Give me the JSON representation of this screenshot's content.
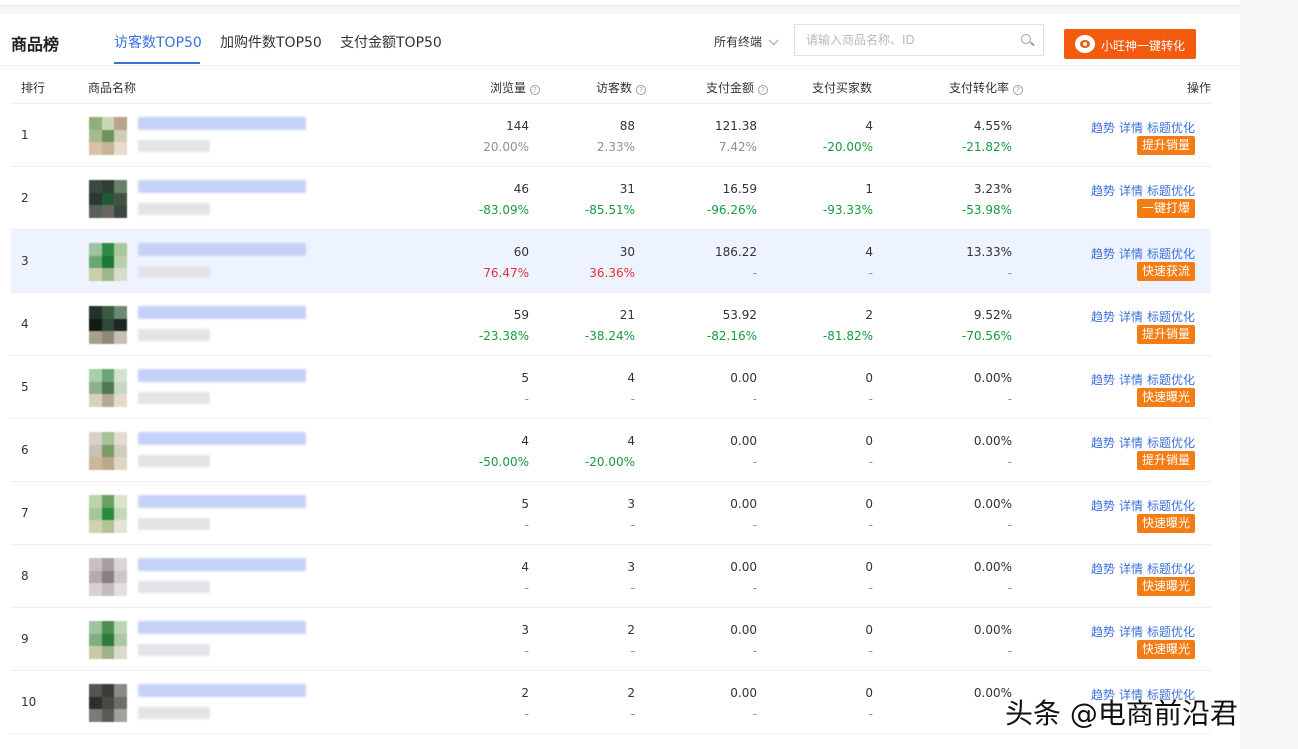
{
  "header": {
    "title": "商品榜",
    "tabs": [
      {
        "label": "访客数TOP50",
        "active": true
      },
      {
        "label": "加购件数TOP50",
        "active": false
      },
      {
        "label": "支付金额TOP50",
        "active": false
      }
    ],
    "device_filter": "所有终端",
    "search_placeholder": "请输入商品名称、ID",
    "convert_button": "小旺神一键转化"
  },
  "colors": {
    "accent": "#3d6fdb",
    "brand_orange": "#f35a0e",
    "tag_orange": "#f37c14",
    "down_green": "#1a9a3c",
    "up_red": "#e0313a"
  },
  "table": {
    "columns": {
      "rank": "排行",
      "name": "商品名称",
      "views": "浏览量",
      "visitors": "访客数",
      "pay_amount": "支付金额",
      "buyers": "支付买家数",
      "conversion": "支付转化率",
      "ops": "操作"
    },
    "op_links": {
      "trend": "趋势",
      "detail": "详情",
      "title_opt": "标题优化"
    },
    "rows": [
      {
        "rank": "1",
        "views": "144",
        "views_chg": "20.00%",
        "visitors": "88",
        "visitors_chg": "2.33%",
        "pay": "121.38",
        "pay_chg": "7.42%",
        "buyers": "4",
        "buyers_chg": "-20.00%",
        "conv": "4.55%",
        "conv_chg": "-21.82%",
        "action": "提升销量"
      },
      {
        "rank": "2",
        "views": "46",
        "views_chg": "-83.09%",
        "visitors": "31",
        "visitors_chg": "-85.51%",
        "pay": "16.59",
        "pay_chg": "-96.26%",
        "buyers": "1",
        "buyers_chg": "-93.33%",
        "conv": "3.23%",
        "conv_chg": "-53.98%",
        "action": "一键打爆"
      },
      {
        "rank": "3",
        "views": "60",
        "views_chg": "76.47%",
        "visitors": "30",
        "visitors_chg": "36.36%",
        "pay": "186.22",
        "pay_chg": "-",
        "buyers": "4",
        "buyers_chg": "-",
        "conv": "13.33%",
        "conv_chg": "-",
        "action": "快速获流"
      },
      {
        "rank": "4",
        "views": "59",
        "views_chg": "-23.38%",
        "visitors": "21",
        "visitors_chg": "-38.24%",
        "pay": "53.92",
        "pay_chg": "-82.16%",
        "buyers": "2",
        "buyers_chg": "-81.82%",
        "conv": "9.52%",
        "conv_chg": "-70.56%",
        "action": "提升销量"
      },
      {
        "rank": "5",
        "views": "5",
        "views_chg": "-",
        "visitors": "4",
        "visitors_chg": "-",
        "pay": "0.00",
        "pay_chg": "-",
        "buyers": "0",
        "buyers_chg": "-",
        "conv": "0.00%",
        "conv_chg": "-",
        "action": "快速曝光"
      },
      {
        "rank": "6",
        "views": "4",
        "views_chg": "-50.00%",
        "visitors": "4",
        "visitors_chg": "-20.00%",
        "pay": "0.00",
        "pay_chg": "-",
        "buyers": "0",
        "buyers_chg": "-",
        "conv": "0.00%",
        "conv_chg": "-",
        "action": "提升销量"
      },
      {
        "rank": "7",
        "views": "5",
        "views_chg": "-",
        "visitors": "3",
        "visitors_chg": "-",
        "pay": "0.00",
        "pay_chg": "-",
        "buyers": "0",
        "buyers_chg": "-",
        "conv": "0.00%",
        "conv_chg": "-",
        "action": "快速曝光"
      },
      {
        "rank": "8",
        "views": "4",
        "views_chg": "-",
        "visitors": "3",
        "visitors_chg": "-",
        "pay": "0.00",
        "pay_chg": "-",
        "buyers": "0",
        "buyers_chg": "-",
        "conv": "0.00%",
        "conv_chg": "-",
        "action": "快速曝光"
      },
      {
        "rank": "9",
        "views": "3",
        "views_chg": "-",
        "visitors": "2",
        "visitors_chg": "-",
        "pay": "0.00",
        "pay_chg": "-",
        "buyers": "0",
        "buyers_chg": "-",
        "conv": "0.00%",
        "conv_chg": "-",
        "action": "快速曝光"
      },
      {
        "rank": "10",
        "views": "2",
        "views_chg": "-",
        "visitors": "2",
        "visitors_chg": "-",
        "pay": "0.00",
        "pay_chg": "-",
        "buyers": "0",
        "buyers_chg": "-",
        "conv": "0.00%",
        "conv_chg": "-",
        "action": ""
      }
    ]
  },
  "watermark": "头条 @电商前沿君"
}
